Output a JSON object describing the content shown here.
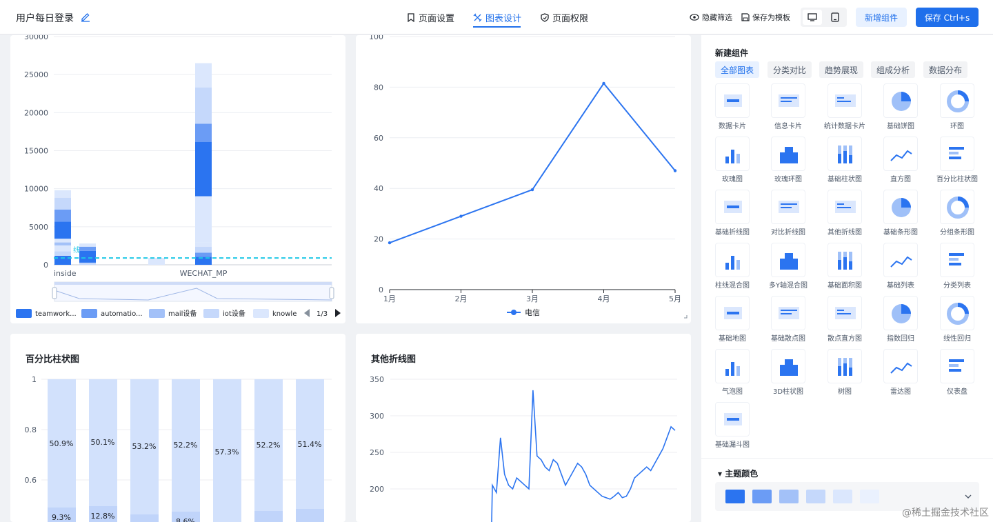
{
  "header": {
    "title": "用户每日登录",
    "tabs": [
      {
        "label": "页面设置",
        "icon": "bookmark-icon"
      },
      {
        "label": "图表设计",
        "icon": "chart-design-icon"
      },
      {
        "label": "页面权限",
        "icon": "shield-icon"
      }
    ],
    "active_tab": "图表设计",
    "hide_filter_label": "隐藏筛选",
    "save_template_label": "保存为模板",
    "add_component_label": "新增组件",
    "save_label": "保存 Ctrl+s"
  },
  "charts": {
    "stacked_bar": {
      "y_ticks": [
        "30000",
        "25000",
        "20000",
        "15000",
        "10000",
        "5000",
        "0"
      ],
      "x_ticks": [
        "inside",
        "WECHAT_MP"
      ],
      "legend": [
        "teamwork...",
        "automatio...",
        "mail设备",
        "iot设备",
        "knowle"
      ],
      "legend_colors": [
        "#2b74f0",
        "#6b9cf5",
        "#a3c1f8",
        "#c5d8fb",
        "#dbe7fd"
      ],
      "pager": "1/3",
      "ref_line_label": "线"
    },
    "line": {
      "y_ticks": [
        "100",
        "80",
        "60",
        "40",
        "20",
        "0"
      ],
      "legend": "电信"
    },
    "percent_bar": {
      "title": "百分比柱状图",
      "y_ticks": [
        "1",
        "0.8",
        "0.6"
      ],
      "top_labels": [
        "50.9%",
        "50.1%",
        "53.2%",
        "52.2%",
        "57.3%",
        "52.2%",
        "51.4%"
      ],
      "bottom_labels": [
        "9.3%",
        "12.8%",
        "",
        "8.6%",
        "",
        "",
        ""
      ]
    },
    "other_line": {
      "title": "其他折线图",
      "y_ticks": [
        "350",
        "300",
        "250",
        "200"
      ]
    }
  },
  "chart_data": [
    {
      "type": "bar",
      "title": "",
      "categories": [
        "inside",
        "",
        "",
        "",
        "",
        "WECHAT_MP"
      ],
      "stacked": true,
      "series_totals": [
        9800,
        2800,
        0,
        900,
        0,
        26500
      ],
      "ylim": [
        0,
        30000
      ],
      "reference_line": 900
    },
    {
      "type": "line",
      "title": "",
      "x": [
        "1月",
        "2月",
        "3月",
        "4月",
        "5月"
      ],
      "series": [
        {
          "name": "电信",
          "values": [
            18.5,
            29,
            39.5,
            81.5,
            47
          ]
        }
      ],
      "ylim": [
        0,
        100
      ]
    },
    {
      "type": "bar",
      "title": "百分比柱状图",
      "categories": [
        "",
        "",
        "",
        "",
        "",
        "",
        ""
      ],
      "series": [
        {
          "name": "",
          "values": [
            0.509,
            0.501,
            0.532,
            0.522,
            0.573,
            0.522,
            0.514
          ]
        },
        {
          "name": "",
          "values": [
            0.093,
            0.128,
            0,
            0.086,
            0,
            0,
            0
          ]
        }
      ],
      "ylim": [
        0,
        1
      ]
    },
    {
      "type": "line",
      "title": "其他折线图",
      "series": [
        {
          "name": "",
          "values": [
            205,
            195,
            270,
            220,
            205,
            200,
            215,
            210,
            205,
            200,
            335,
            245,
            240,
            230,
            225,
            240,
            235,
            220,
            205,
            215,
            225,
            235,
            230,
            220,
            205,
            200,
            195,
            190,
            188,
            186,
            190,
            195,
            188,
            190,
            200,
            215,
            220,
            225,
            230,
            225,
            235,
            245,
            255,
            270,
            285,
            280
          ]
        }
      ],
      "ylim": [
        150,
        350
      ]
    }
  ],
  "panel": {
    "title": "新建组件",
    "categories": [
      "全部图表",
      "分类对比",
      "趋势展现",
      "组成分析",
      "数据分布"
    ],
    "items": [
      {
        "label": "数据卡片",
        "icon": "data-card-icon"
      },
      {
        "label": "信息卡片",
        "icon": "info-card-icon"
      },
      {
        "label": "统计数据卡片",
        "icon": "stat-card-icon"
      },
      {
        "label": "基础饼图",
        "icon": "pie-icon"
      },
      {
        "label": "环图",
        "icon": "donut-icon"
      },
      {
        "label": "玫瑰图",
        "icon": "rose-icon"
      },
      {
        "label": "玫瑰环图",
        "icon": "rose-ring-icon"
      },
      {
        "label": "基础柱状图",
        "icon": "bar-icon"
      },
      {
        "label": "直方图",
        "icon": "histogram-icon"
      },
      {
        "label": "百分比柱状图",
        "icon": "percent-bar-icon"
      },
      {
        "label": "基础折线图",
        "icon": "line-icon"
      },
      {
        "label": "对比折线图",
        "icon": "compare-line-icon"
      },
      {
        "label": "其他折线图",
        "icon": "other-line-icon"
      },
      {
        "label": "基础条形图",
        "icon": "hbar-icon"
      },
      {
        "label": "分组条形图",
        "icon": "group-hbar-icon"
      },
      {
        "label": "柱线混合图",
        "icon": "bar-line-icon"
      },
      {
        "label": "多Y轴混合图",
        "icon": "multi-y-icon"
      },
      {
        "label": "基础面积图",
        "icon": "area-icon"
      },
      {
        "label": "基础列表",
        "icon": "list-icon"
      },
      {
        "label": "分类列表",
        "icon": "category-list-icon"
      },
      {
        "label": "基础地图",
        "icon": "map-icon"
      },
      {
        "label": "基础散点图",
        "icon": "scatter-icon"
      },
      {
        "label": "散点直方图",
        "icon": "scatter-hist-icon"
      },
      {
        "label": "指数回归",
        "icon": "exp-regression-icon"
      },
      {
        "label": "线性回归",
        "icon": "linear-regression-icon"
      },
      {
        "label": "气泡图",
        "icon": "bubble-icon"
      },
      {
        "label": "3D柱状图",
        "icon": "bar3d-icon"
      },
      {
        "label": "树图",
        "icon": "tree-icon"
      },
      {
        "label": "雷达图",
        "icon": "radar-icon"
      },
      {
        "label": "仪表盘",
        "icon": "gauge-icon"
      },
      {
        "label": "基础漏斗图",
        "icon": "funnel-icon"
      }
    ],
    "theme_title": "主题颜色",
    "theme_colors": [
      "#2b74f0",
      "#6b9cf5",
      "#a3c1f8",
      "#c5d8fb",
      "#dbe7fd",
      "#eaf1fe"
    ]
  },
  "watermark": "@稀土掘金技术社区"
}
